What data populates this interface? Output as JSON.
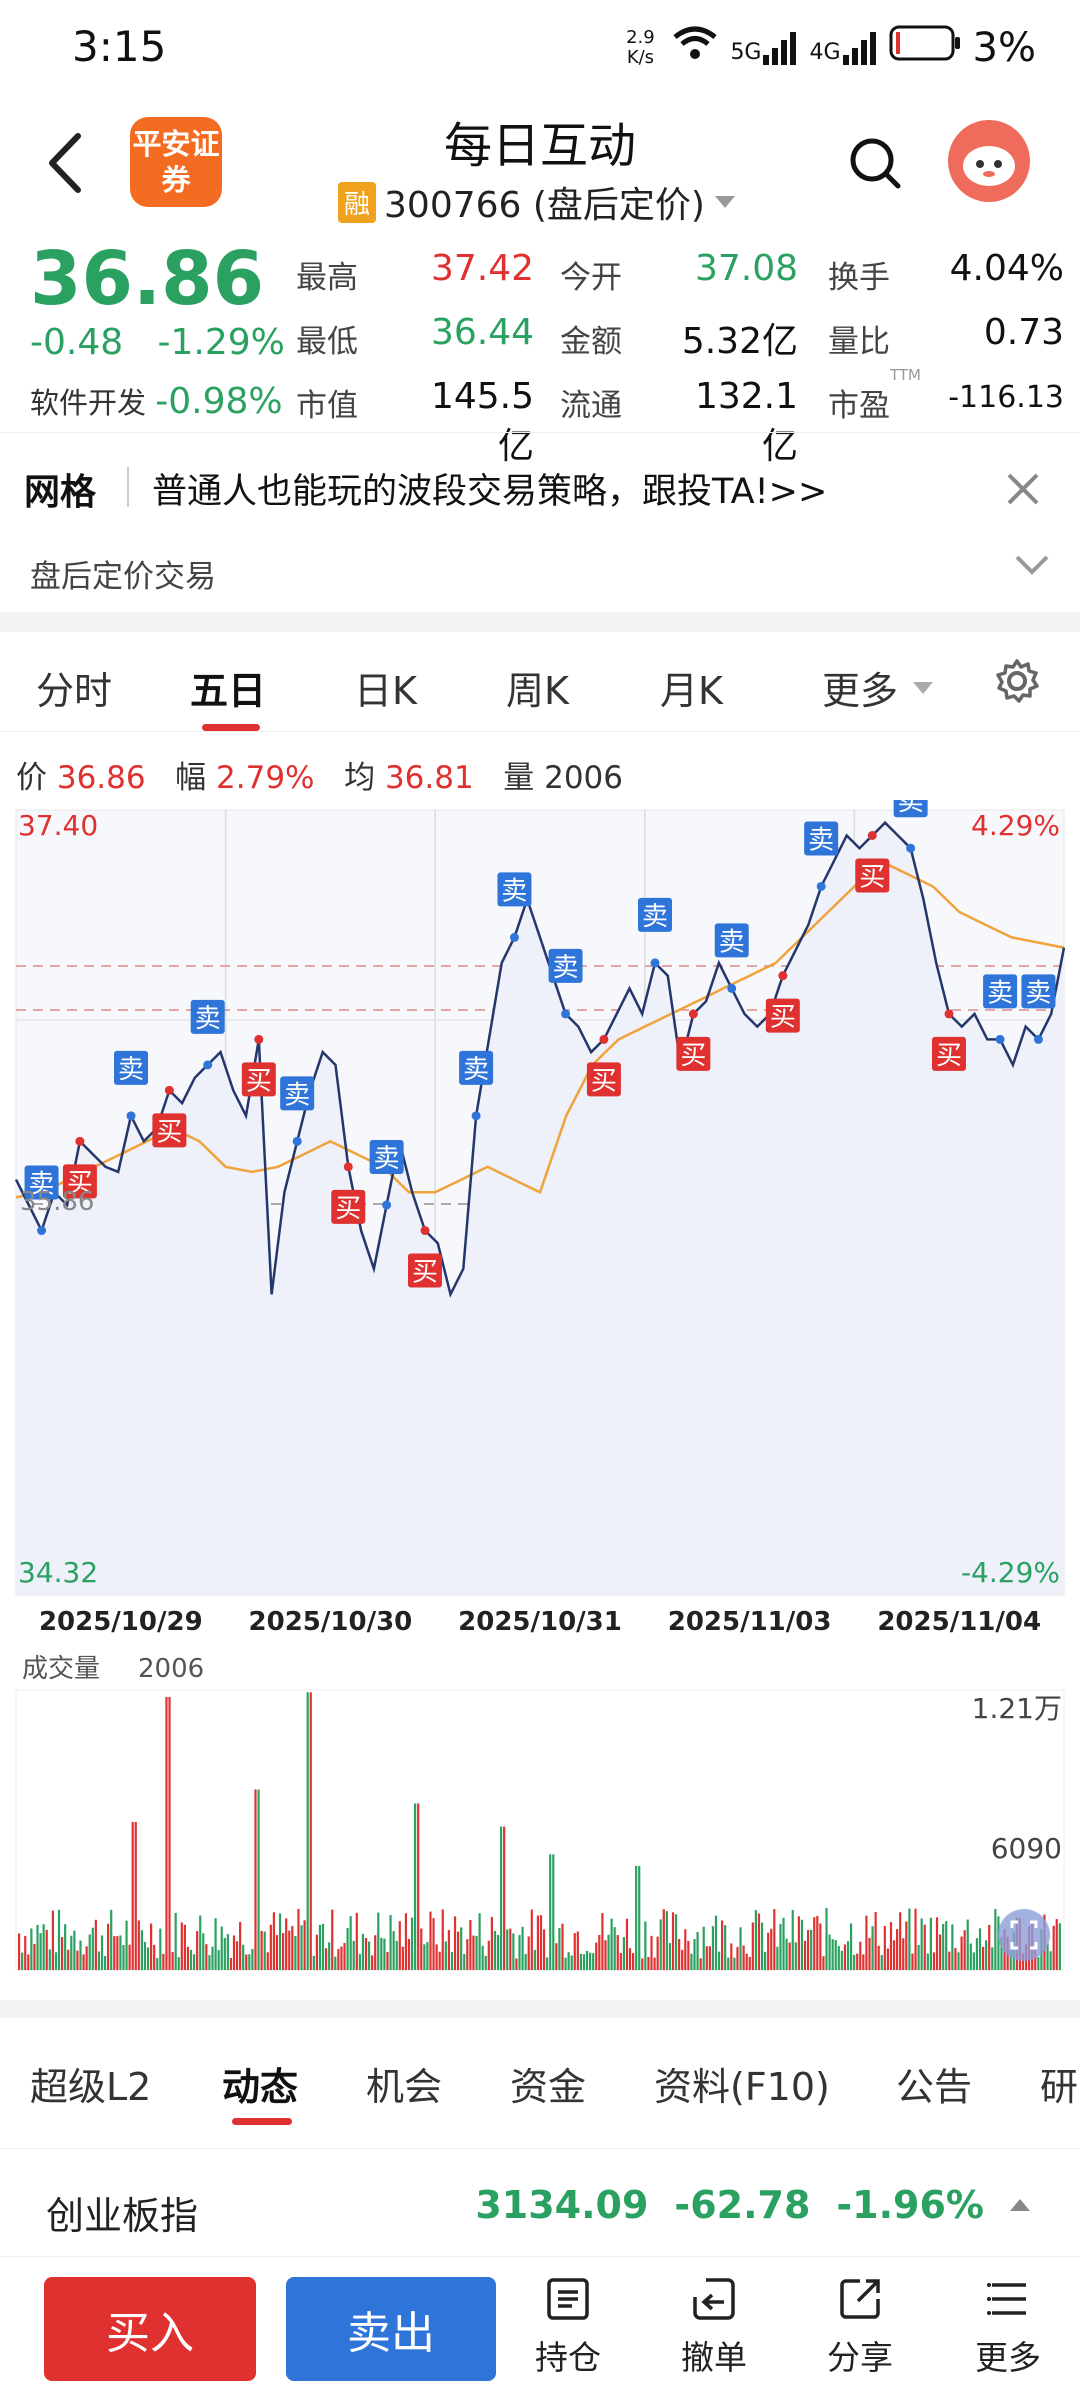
{
  "status_bar": {
    "time": "3:15",
    "net_speed": "2.9 K/s",
    "net_5g": "5G",
    "net_4g": "4G",
    "battery": "3%"
  },
  "header": {
    "broker_logo_text": "平安证券",
    "title": "每日互动",
    "margin_badge": "融",
    "subtitle": "300766 (盘后定价)"
  },
  "quote": {
    "price": "36.86",
    "change": "-0.48",
    "change_pct": "-1.29%",
    "industry": "软件开发",
    "industry_pct": "-0.98%",
    "fields": [
      {
        "label": "最高",
        "value": "37.42",
        "color": "red"
      },
      {
        "label": "今开",
        "value": "37.08",
        "color": "green"
      },
      {
        "label": "换手",
        "value": "4.04%",
        "color": "black"
      },
      {
        "label": "最低",
        "value": "36.44",
        "color": "green"
      },
      {
        "label": "金额",
        "value": "5.32亿",
        "color": "black"
      },
      {
        "label": "量比",
        "value": "0.73",
        "color": "black"
      },
      {
        "label": "市值",
        "value": "145.5亿",
        "color": "black"
      },
      {
        "label": "流通",
        "value": "132.1亿",
        "color": "black"
      },
      {
        "label": "市盈",
        "value": "-116.13",
        "color": "black",
        "sup": "TTM"
      }
    ]
  },
  "banner": {
    "tag": "网格",
    "text": "普通人也能玩的波段交易策略，跟投TA!>>",
    "after_hours": "盘后定价交易"
  },
  "period_tabs": [
    "分时",
    "五日",
    "日K",
    "周K",
    "月K",
    "更多"
  ],
  "info_line": {
    "price_label": "价",
    "price": "36.86",
    "amp_label": "幅",
    "amp": "2.79%",
    "avg_label": "均",
    "avg": "36.81",
    "vol_label": "量",
    "vol": "2006"
  },
  "chart_labels": {
    "y_top": "37.40",
    "y_bottom": "34.32",
    "y_prev": "35.86",
    "pct_top": "4.29%",
    "pct_bottom": "-4.29%",
    "vol_title": "成交量",
    "vol_value": "2006",
    "vol_top": "1.21万",
    "vol_mid": "6090"
  },
  "chart_data": {
    "type": "line",
    "x_ticks": [
      "2025/10/29",
      "2025/10/30",
      "2025/10/31",
      "2025/11/03",
      "2025/11/04"
    ],
    "ylim": [
      34.32,
      37.4
    ],
    "series": [
      {
        "name": "价",
        "values": [
          35.95,
          35.85,
          35.75,
          35.9,
          35.85,
          36.1,
          36.05,
          36.0,
          35.98,
          36.2,
          36.1,
          36.15,
          36.3,
          36.25,
          36.35,
          36.4,
          36.45,
          36.3,
          36.2,
          36.5,
          35.5,
          35.9,
          36.1,
          36.3,
          36.45,
          36.4,
          36.0,
          35.75,
          35.6,
          35.85,
          36.1,
          35.9,
          35.75,
          35.7,
          35.5,
          35.6,
          36.2,
          36.5,
          36.8,
          36.9,
          37.05,
          36.9,
          36.75,
          36.6,
          36.55,
          36.45,
          36.5,
          36.6,
          36.7,
          36.6,
          36.8,
          36.75,
          36.4,
          36.6,
          36.65,
          36.8,
          36.7,
          36.6,
          36.55,
          36.6,
          36.75,
          36.85,
          36.95,
          37.1,
          37.2,
          37.3,
          37.25,
          37.3,
          37.35,
          37.3,
          37.25,
          37.05,
          36.8,
          36.6,
          36.55,
          36.6,
          36.5,
          36.5,
          36.4,
          36.55,
          36.5,
          36.6,
          36.86
        ]
      },
      {
        "name": "均",
        "values": [
          35.88,
          35.9,
          35.95,
          36.0,
          36.05,
          36.1,
          36.15,
          36.1,
          36.0,
          35.98,
          36.0,
          36.05,
          36.1,
          36.05,
          36.0,
          35.9,
          35.9,
          35.95,
          36.0,
          35.95,
          35.9,
          36.2,
          36.4,
          36.5,
          36.55,
          36.6,
          36.65,
          36.7,
          36.75,
          36.8,
          36.9,
          37.0,
          37.1,
          37.2,
          37.15,
          37.1,
          37.0,
          36.95,
          36.9,
          36.88,
          36.86
        ]
      }
    ],
    "signals": [
      {
        "label": "卖"
      },
      {
        "label": "买"
      },
      {
        "label": "卖"
      },
      {
        "label": "买"
      },
      {
        "label": "卖"
      },
      {
        "label": "买"
      },
      {
        "label": "卖"
      },
      {
        "label": "买"
      },
      {
        "label": "卖"
      },
      {
        "label": "买"
      },
      {
        "label": "卖"
      },
      {
        "label": "卖"
      },
      {
        "label": "卖"
      },
      {
        "label": "买"
      },
      {
        "label": "卖"
      },
      {
        "label": "买"
      },
      {
        "label": "卖"
      },
      {
        "label": "买"
      },
      {
        "label": "卖"
      },
      {
        "label": "买"
      },
      {
        "label": "卖"
      },
      {
        "label": "买"
      },
      {
        "label": "卖"
      },
      {
        "label": "卖"
      }
    ],
    "volume_ylim": [
      0,
      12100
    ]
  },
  "function_tabs": [
    "超级L2",
    "动态",
    "机会",
    "资金",
    "资料(F10)",
    "公告",
    "研"
  ],
  "index_row": {
    "name": "创业板指",
    "value": "3134.09",
    "change": "-62.78",
    "change_pct": "-1.96%"
  },
  "bottom_bar": {
    "buy": "买入",
    "sell": "卖出",
    "items": [
      "持仓",
      "撤单",
      "分享",
      "更多"
    ]
  },
  "colors": {
    "up": "#e03131",
    "down": "#2aa160",
    "sell_btn": "#2f74d8",
    "avg_line": "#f0a23b",
    "price_line": "#24366b"
  }
}
